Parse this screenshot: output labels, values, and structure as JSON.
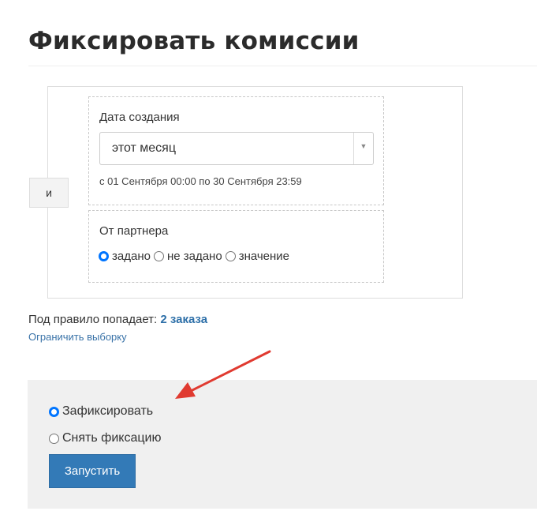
{
  "page": {
    "title": "Фиксировать комиссии"
  },
  "filter": {
    "logic_operator": "и",
    "date_condition": {
      "label": "Дата создания",
      "selected_value": "этот месяц",
      "range_text": "с 01 Сентября 00:00 по 30 Сентября 23:59"
    },
    "partner_condition": {
      "label": "От партнера",
      "options": [
        {
          "label": "задано",
          "checked": true
        },
        {
          "label": "не задано",
          "checked": false
        },
        {
          "label": "значение",
          "checked": false
        }
      ]
    }
  },
  "summary": {
    "prefix": "Под правило попадает:",
    "count_link": "2 заказа",
    "limit_link": "Ограничить выборку"
  },
  "action": {
    "options": [
      {
        "label": "Зафиксировать",
        "checked": true
      },
      {
        "label": "Снять фиксацию",
        "checked": false
      }
    ],
    "run_label": "Запустить"
  },
  "colors": {
    "primary_button": "#337ab7",
    "link": "#2d6fa8",
    "radio_checked": "#0075ff",
    "annotation_arrow": "#e03a30",
    "panel_background": "#f0f0f0"
  },
  "icons": {
    "select_arrow": "caret-down-icon",
    "annotation": "red-arrow-icon"
  }
}
